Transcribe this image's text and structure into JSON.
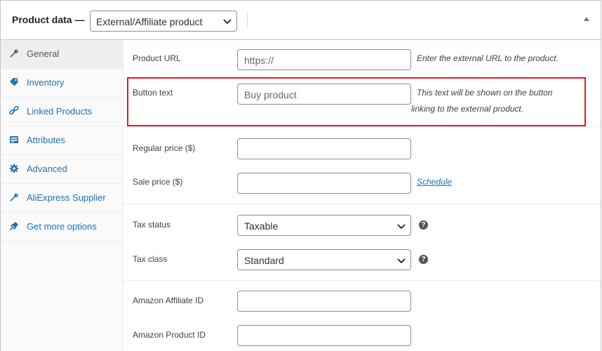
{
  "header": {
    "title": "Product data —",
    "product_type": "External/Affiliate product"
  },
  "sidebar": {
    "items": [
      {
        "label": "General",
        "icon": "wrench-icon",
        "active": true
      },
      {
        "label": "Inventory",
        "icon": "tag-icon",
        "active": false
      },
      {
        "label": "Linked Products",
        "icon": "link-icon",
        "active": false
      },
      {
        "label": "Attributes",
        "icon": "list-icon",
        "active": false
      },
      {
        "label": "Advanced",
        "icon": "gear-icon",
        "active": false
      },
      {
        "label": "AliExpress Supplier",
        "icon": "wrench-icon",
        "active": false
      },
      {
        "label": "Get more options",
        "icon": "plugin-icon",
        "active": false
      }
    ]
  },
  "fields": {
    "product_url": {
      "label": "Product URL",
      "placeholder": "https://",
      "description": "Enter the external URL to the product."
    },
    "button_text": {
      "label": "Button text",
      "placeholder": "Buy product",
      "description_line1": "This text will be shown on the button",
      "description_line2": "linking to the external product."
    },
    "regular_price": {
      "label": "Regular price ($)",
      "value": ""
    },
    "sale_price": {
      "label": "Sale price ($)",
      "value": "",
      "schedule_link": "Schedule"
    },
    "tax_status": {
      "label": "Tax status",
      "value": "Taxable"
    },
    "tax_class": {
      "label": "Tax class",
      "value": "Standard"
    },
    "amazon_affiliate_id": {
      "label": "Amazon Affiliate ID",
      "value": ""
    },
    "amazon_product_id": {
      "label": "Amazon Product ID",
      "value": ""
    }
  },
  "colors": {
    "link": "#2271b1",
    "highlight_border": "#e01b24"
  }
}
